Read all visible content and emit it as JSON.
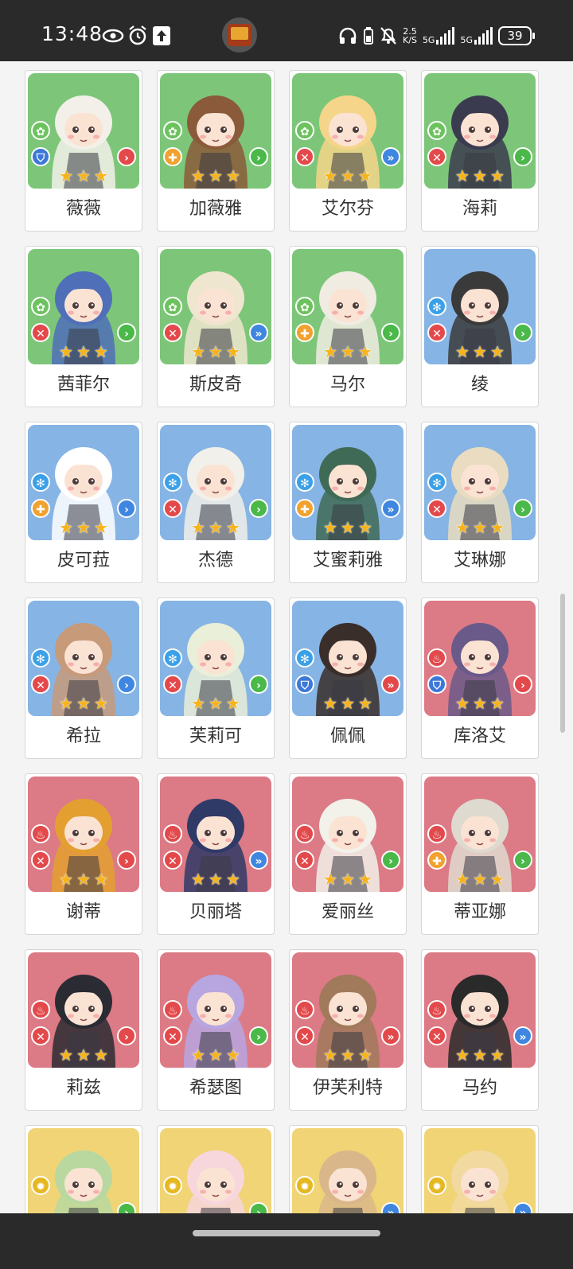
{
  "status_bar": {
    "time": "13:48",
    "net_speed_top": "2.5",
    "net_speed_bottom": "K/S",
    "sim1_label": "5G",
    "sim2_label": "5G",
    "battery": "39",
    "icons": [
      "eye-icon",
      "alarm-icon",
      "upload-icon",
      "app-icon",
      "headphones-icon",
      "battery-saver-icon",
      "bell-off-icon",
      "signal-icon",
      "signal-icon",
      "battery-icon"
    ]
  },
  "colors": {
    "green": "#7dc679",
    "blue": "#86b4e4",
    "red": "#dc7a86",
    "yellow": "#f0d476",
    "star": "#f6b41a",
    "element_green": "#6cc25d",
    "element_blue": "#3aa1e8",
    "element_red": "#e3494b",
    "element_yellow": "#e6b820",
    "role_red": "#e3494b",
    "role_orange": "#f1a12e",
    "role_blue": "#3c78d8",
    "atk_green": "#4bb84a",
    "atk_blue": "#3f86e0",
    "atk_red": "#e3494b"
  },
  "characters": [
    {
      "name": "薇薇",
      "bg": "green",
      "element": "leaf-icon",
      "role": "shield-icon",
      "role_color": "blue",
      "attack": "chevron-icon",
      "attack_color": "red",
      "stars": 3
    },
    {
      "name": "加薇雅",
      "bg": "green",
      "element": "leaf-icon",
      "role": "cross-icon",
      "role_color": "orange",
      "attack": "chevron-icon",
      "attack_color": "green",
      "stars": 3
    },
    {
      "name": "艾尔芬",
      "bg": "green",
      "element": "leaf-icon",
      "role": "swords-icon",
      "role_color": "red",
      "attack": "double-chevron-icon",
      "attack_color": "blue",
      "stars": 3
    },
    {
      "name": "海莉",
      "bg": "green",
      "element": "leaf-icon",
      "role": "swords-icon",
      "role_color": "red",
      "attack": "chevron-icon",
      "attack_color": "green",
      "stars": 3
    },
    {
      "name": "茜菲尔",
      "bg": "green",
      "element": "leaf-icon",
      "role": "swords-icon",
      "role_color": "red",
      "attack": "chevron-icon",
      "attack_color": "green",
      "stars": 3
    },
    {
      "name": "斯皮奇",
      "bg": "green",
      "element": "leaf-icon",
      "role": "swords-icon",
      "role_color": "red",
      "attack": "double-chevron-icon",
      "attack_color": "blue",
      "stars": 3
    },
    {
      "name": "马尔",
      "bg": "green",
      "element": "leaf-icon",
      "role": "cross-icon",
      "role_color": "orange",
      "attack": "chevron-icon",
      "attack_color": "green",
      "stars": 3
    },
    {
      "name": "绫",
      "bg": "blue",
      "element": "snowflake-icon",
      "role": "swords-icon",
      "role_color": "red",
      "attack": "chevron-icon",
      "attack_color": "green",
      "stars": 3
    },
    {
      "name": "皮可菈",
      "bg": "blue",
      "element": "snowflake-icon",
      "role": "cross-icon",
      "role_color": "orange",
      "attack": "chevron-icon",
      "attack_color": "blue",
      "stars": 3
    },
    {
      "name": "杰德",
      "bg": "blue",
      "element": "snowflake-icon",
      "role": "swords-icon",
      "role_color": "red",
      "attack": "chevron-icon",
      "attack_color": "green",
      "stars": 3
    },
    {
      "name": "艾蜜莉雅",
      "bg": "blue",
      "element": "snowflake-icon",
      "role": "cross-icon",
      "role_color": "orange",
      "attack": "double-chevron-icon",
      "attack_color": "blue",
      "stars": 3
    },
    {
      "name": "艾琳娜",
      "bg": "blue",
      "element": "snowflake-icon",
      "role": "swords-icon",
      "role_color": "red",
      "attack": "chevron-icon",
      "attack_color": "green",
      "stars": 3
    },
    {
      "name": "希拉",
      "bg": "blue",
      "element": "snowflake-icon",
      "role": "swords-icon",
      "role_color": "red",
      "attack": "chevron-icon",
      "attack_color": "blue",
      "stars": 3
    },
    {
      "name": "芙莉可",
      "bg": "blue",
      "element": "snowflake-icon",
      "role": "swords-icon",
      "role_color": "red",
      "attack": "chevron-icon",
      "attack_color": "green",
      "stars": 3
    },
    {
      "name": "佩佩",
      "bg": "blue",
      "element": "snowflake-icon",
      "role": "shield-icon",
      "role_color": "blue",
      "attack": "double-chevron-icon",
      "attack_color": "red",
      "stars": 3
    },
    {
      "name": "库洛艾",
      "bg": "red",
      "element": "flame-icon",
      "role": "shield-icon",
      "role_color": "blue",
      "attack": "chevron-icon",
      "attack_color": "red",
      "stars": 3
    },
    {
      "name": "谢蒂",
      "bg": "red",
      "element": "flame-icon",
      "role": "swords-icon",
      "role_color": "red",
      "attack": "chevron-icon",
      "attack_color": "red",
      "stars": 3
    },
    {
      "name": "贝丽塔",
      "bg": "red",
      "element": "flame-icon",
      "role": "swords-icon",
      "role_color": "red",
      "attack": "double-chevron-icon",
      "attack_color": "blue",
      "stars": 3
    },
    {
      "name": "爱丽丝",
      "bg": "red",
      "element": "flame-icon",
      "role": "swords-icon",
      "role_color": "red",
      "attack": "chevron-icon",
      "attack_color": "green",
      "stars": 3
    },
    {
      "name": "蒂亚娜",
      "bg": "red",
      "element": "flame-icon",
      "role": "cross-icon",
      "role_color": "orange",
      "attack": "chevron-icon",
      "attack_color": "green",
      "stars": 3
    },
    {
      "name": "莉兹",
      "bg": "red",
      "element": "flame-icon",
      "role": "swords-icon",
      "role_color": "red",
      "attack": "chevron-icon",
      "attack_color": "red",
      "stars": 3
    },
    {
      "name": "希瑟图",
      "bg": "red",
      "element": "flame-icon",
      "role": "swords-icon",
      "role_color": "red",
      "attack": "chevron-icon",
      "attack_color": "green",
      "stars": 3
    },
    {
      "name": "伊芙利特",
      "bg": "red",
      "element": "flame-icon",
      "role": "swords-icon",
      "role_color": "red",
      "attack": "double-chevron-icon",
      "attack_color": "red",
      "stars": 3
    },
    {
      "name": "马约",
      "bg": "red",
      "element": "flame-icon",
      "role": "swords-icon",
      "role_color": "red",
      "attack": "double-chevron-icon",
      "attack_color": "blue",
      "stars": 3
    },
    {
      "name": "",
      "bg": "yellow",
      "element": "sun-icon",
      "role": "",
      "role_color": "",
      "attack": "chevron-icon",
      "attack_color": "green",
      "stars": 0
    },
    {
      "name": "",
      "bg": "yellow",
      "element": "sun-icon",
      "role": "",
      "role_color": "",
      "attack": "chevron-icon",
      "attack_color": "green",
      "stars": 0
    },
    {
      "name": "",
      "bg": "yellow",
      "element": "sun-icon",
      "role": "",
      "role_color": "",
      "attack": "double-chevron-icon",
      "attack_color": "blue",
      "stars": 0
    },
    {
      "name": "",
      "bg": "yellow",
      "element": "sun-icon",
      "role": "",
      "role_color": "",
      "attack": "double-chevron-icon",
      "attack_color": "blue",
      "stars": 0
    }
  ]
}
